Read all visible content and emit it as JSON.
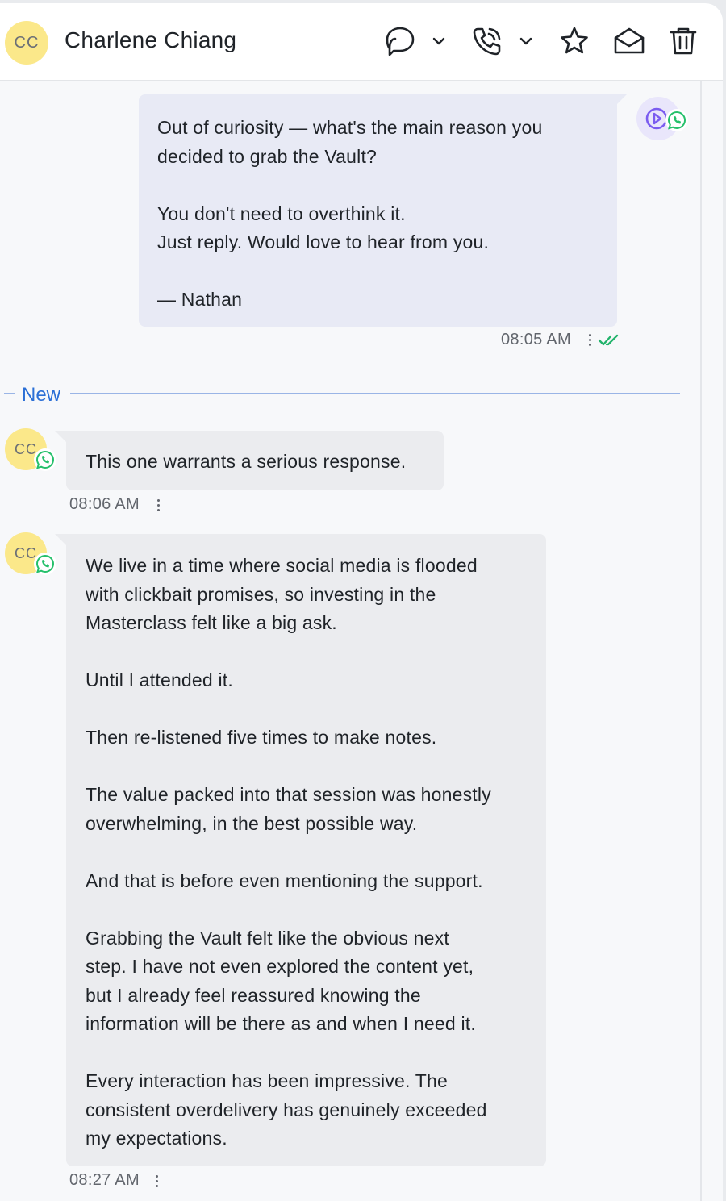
{
  "header": {
    "avatar_initials": "CC",
    "contact_name": "Charlene Chiang",
    "icons": [
      "chat-bubble-icon",
      "chevron-down-icon",
      "phone-icon",
      "chevron-down-icon",
      "star-icon",
      "mail-open-icon",
      "trash-icon"
    ]
  },
  "messages": [
    {
      "direction": "outgoing",
      "lines": [
        "Out of curiosity — what's the main reason you",
        "decided to grab the Vault?",
        "",
        "You don't need to overthink it.",
        "Just reply. Would love to hear from you.",
        "",
        "— Nathan"
      ],
      "time": "08:05 AM",
      "status": "read"
    },
    {
      "direction": "incoming",
      "avatar_initials": "CC",
      "lines": [
        "This one warrants a serious response."
      ],
      "time": "08:06 AM"
    },
    {
      "direction": "incoming",
      "avatar_initials": "CC",
      "lines": [
        "We live in a time where social media is flooded",
        "with clickbait promises, so investing in the",
        "Masterclass felt like a big ask.",
        "",
        "Until I attended it.",
        "",
        "Then re-listened five times to make notes.",
        "",
        "The value packed into that session was honestly",
        "overwhelming, in the best possible way.",
        "",
        "And that is before even mentioning the support.",
        "",
        "Grabbing the Vault felt like the obvious next",
        "step. I have not even explored the content yet,",
        "but I already feel reassured knowing the",
        "information will be there as and when I need it.",
        "",
        "Every interaction has been impressive. The",
        "consistent overdelivery has genuinely exceeded",
        "my expectations."
      ],
      "time": "08:27 AM"
    }
  ],
  "divider": {
    "label": "New"
  },
  "colors": {
    "accent_blue": "#2b6fd6",
    "whatsapp_green": "#25c06b",
    "read_check": "#22b36b",
    "avatar_yellow": "#fbe88a",
    "agent_purple": "#7b5cf0"
  }
}
